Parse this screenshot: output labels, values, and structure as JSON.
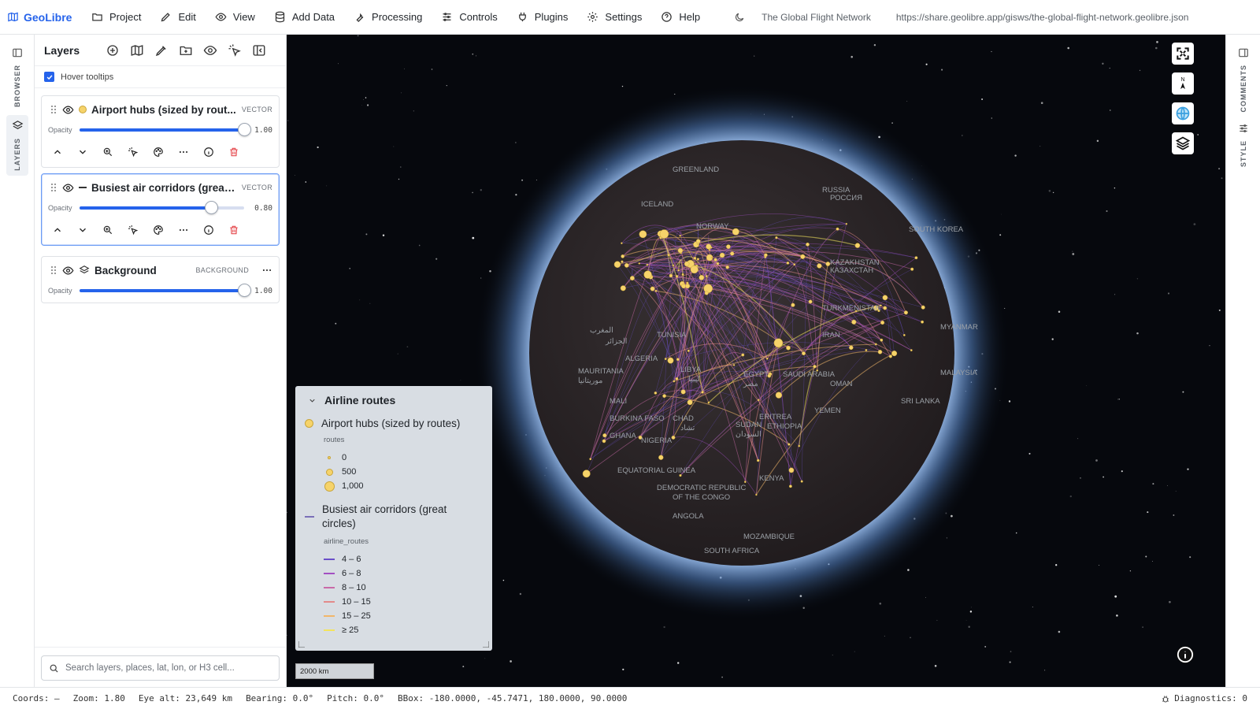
{
  "app": {
    "name": "GeoLibre",
    "project_title": "The Global Flight Network",
    "share_url": "https://share.geolibre.app/gisws/the-global-flight-network.geolibre.json"
  },
  "menu": {
    "project": "Project",
    "edit": "Edit",
    "view": "View",
    "add_data": "Add Data",
    "processing": "Processing",
    "controls": "Controls",
    "plugins": "Plugins",
    "settings": "Settings",
    "help": "Help"
  },
  "sidebar_tabs": {
    "browser": "BROWSER",
    "layers": "LAYERS"
  },
  "right_tabs": {
    "comments": "COMMENTS",
    "style": "STYLE"
  },
  "layers_panel": {
    "title": "Layers",
    "hover_tooltips": "Hover tooltips",
    "opacity_label": "Opacity",
    "layers": [
      {
        "name": "Airport hubs (sized by rout...",
        "type": "VECTOR",
        "opacity": 1.0,
        "opacity_text": "1.00",
        "swatch": "#f6d36a"
      },
      {
        "name": "Busiest air corridors (great ...",
        "type": "VECTOR",
        "opacity": 0.8,
        "opacity_text": "0.80",
        "swatch": "#333333"
      },
      {
        "name": "Background",
        "type": "BACKGROUND",
        "opacity": 1.0,
        "opacity_text": "1.00"
      }
    ],
    "search_placeholder": "Search layers, places, lat, lon, or H3 cell..."
  },
  "legend": {
    "title": "Airline routes",
    "hubs": {
      "name": "Airport hubs (sized by routes)",
      "field": "routes",
      "classes": [
        "0",
        "500",
        "1,000"
      ]
    },
    "corridors": {
      "name": "Busiest air corridors (great circles)",
      "field": "airline_routes",
      "classes": [
        {
          "label": "4 – 6",
          "color": "#6a4fc9"
        },
        {
          "label": "6 – 8",
          "color": "#a34fc2"
        },
        {
          "label": "8 – 10",
          "color": "#c96aa8"
        },
        {
          "label": "10 – 15",
          "color": "#e38a8a"
        },
        {
          "label": "15 – 25",
          "color": "#f1b66a"
        },
        {
          "label": "≥ 25",
          "color": "#f3e45d"
        }
      ]
    }
  },
  "map": {
    "scale_label": "2000 km",
    "compass_label": "N",
    "place_labels": [
      "GREENLAND",
      "RUSSIA",
      "РОССИЯ",
      "KAZAKHSTAN",
      "КАЗАХСТАН",
      "SOUTH KOREA",
      "NORWAY",
      "TURKMENISTAN",
      "ALGERIA",
      "TUNISIA",
      "LIBYA",
      "ليبيا",
      "EGYPT",
      "مصر",
      "SAUDI ARABIA",
      "IRAN",
      "OMAN",
      "MAURITANIA",
      "موريتانيا",
      "MALI",
      "BURKINA FASO",
      "GHANA",
      "NIGERIA",
      "CHAD",
      "تشاد",
      "SUDAN",
      "السودان",
      "ERITREA",
      "ETHIOPIA",
      "YEMEN",
      "SRI LANKA",
      "MALAYSIA",
      "MYANMAR",
      "EQUATORIAL GUINEA",
      "DEMOCRATIC REPUBLIC",
      "OF THE CONGO",
      "KENYA",
      "ANGOLA",
      "MOZAMBIQUE",
      "SOUTH AFRICA",
      "ICELAND",
      "المغرب",
      "الجزائر"
    ],
    "colors": {
      "globe": "#2a2527",
      "glow": "#9ec6ff",
      "space": "#06080d"
    }
  },
  "status": {
    "coords": "Coords: —",
    "zoom": "Zoom: 1.80",
    "eye_alt": "Eye alt: 23,649 km",
    "bearing": "Bearing: 0.0°",
    "pitch": "Pitch: 0.0°",
    "bbox": "BBox: -180.0000, -45.7471, 180.0000, 90.0000",
    "diagnostics": "Diagnostics: 0"
  },
  "colors": {
    "accent": "#2563eb",
    "delete": "#e5484d"
  }
}
